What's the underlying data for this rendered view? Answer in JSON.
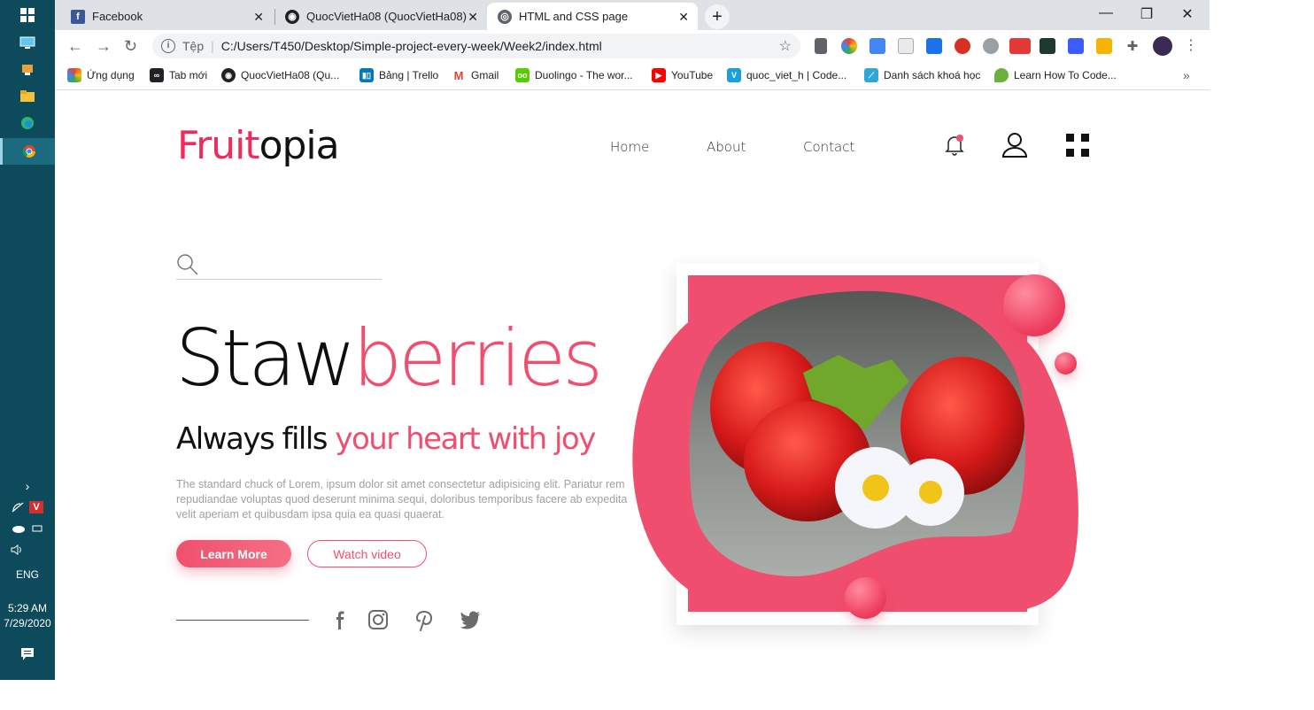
{
  "taskbar": {
    "time": "5:29 AM",
    "date": "7/29/2020",
    "language": "ENG"
  },
  "browser": {
    "tabs": [
      {
        "label": "Facebook",
        "active": false
      },
      {
        "label": "QuocVietHa08 (QuocVietHa08)",
        "active": false
      },
      {
        "label": "HTML and CSS page",
        "active": true
      }
    ],
    "address_prefix": "Tệp",
    "url": "C:/Users/T450/Desktop/Simple-project-every-week/Week2/index.html",
    "bookmarks": [
      {
        "label": "Ứng dụng",
        "icon": "apps-icon",
        "color": "#ea4335"
      },
      {
        "label": "Tab mới",
        "icon": "newtab-icon",
        "color": "#202124"
      },
      {
        "label": "QuocVietHa08 (Qu...",
        "icon": "github-icon",
        "color": "#202124"
      },
      {
        "label": "Bảng | Trello",
        "icon": "trello-icon",
        "color": "#0079bf"
      },
      {
        "label": "Gmail",
        "icon": "gmail-icon",
        "color": "#ea4335"
      },
      {
        "label": "Duolingo - The wor...",
        "icon": "duolingo-icon",
        "color": "#58cc02"
      },
      {
        "label": "YouTube",
        "icon": "youtube-icon",
        "color": "#ff0000"
      },
      {
        "label": "quoc_viet_h | Code...",
        "icon": "codewars-icon",
        "color": "#1a9fe0"
      },
      {
        "label": "Danh sách khoá học",
        "icon": "course-icon",
        "color": "#2ea6d8"
      },
      {
        "label": "Learn How To Code...",
        "icon": "leaf-icon",
        "color": "#6ab23e"
      }
    ]
  },
  "page": {
    "logo_part1": "Fruit",
    "logo_part2": "opia",
    "nav": [
      "Home",
      "About",
      "Contact"
    ],
    "notification_count": "0",
    "hero_title_part1": "Staw",
    "hero_title_part2": "berries",
    "subtitle_part1": "Always fills ",
    "subtitle_part2": "your heart with joy",
    "description": "The standard chuck of Lorem, ipsum dolor sit amet consectetur adipisicing elit. Pariatur rem repudiandae voluptas quod deserunt minima sequi, doloribus temporibus facere ab expedita velit aperiam et quibusdam ipsa quia ea quasi quaerat.",
    "primary_button": "Learn More",
    "secondary_button": "Watch video",
    "accent_color": "#f04e6e",
    "socials": [
      "facebook-icon",
      "instagram-icon",
      "pinterest-icon",
      "twitter-icon"
    ]
  }
}
